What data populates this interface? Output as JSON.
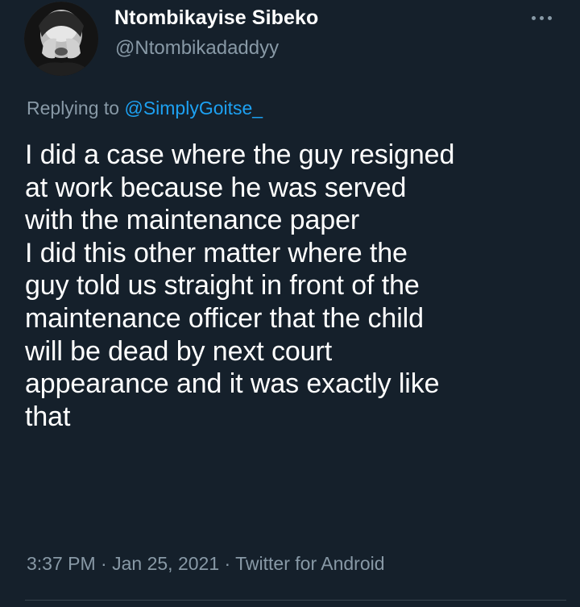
{
  "tweet": {
    "author": {
      "display_name": "Ntombikayise Sibeko",
      "handle": "@Ntombikadaddyy",
      "avatar_icon": "avatar-photo"
    },
    "more_icon": "more-horizontal-icon",
    "reply": {
      "prefix": "Replying to ",
      "mention": "@SimplyGoitse_"
    },
    "text": "I did a case where the guy resigned\nat work because he was served\nwith the maintenance paper\nI did this other matter where the\nguy told us straight in front of the\nmaintenance officer that the child\nwill be dead by next court\nappearance and it was exactly like\nthat",
    "meta": {
      "time": "3:37 PM",
      "separator1": " · ",
      "date": "Jan 25, 2021",
      "separator2": " · ",
      "source": "Twitter for Android"
    }
  },
  "colors": {
    "background": "#15202b",
    "primary_text": "#ffffff",
    "secondary_text": "#8899a6",
    "link": "#1da1f2",
    "divider": "#38444d"
  }
}
